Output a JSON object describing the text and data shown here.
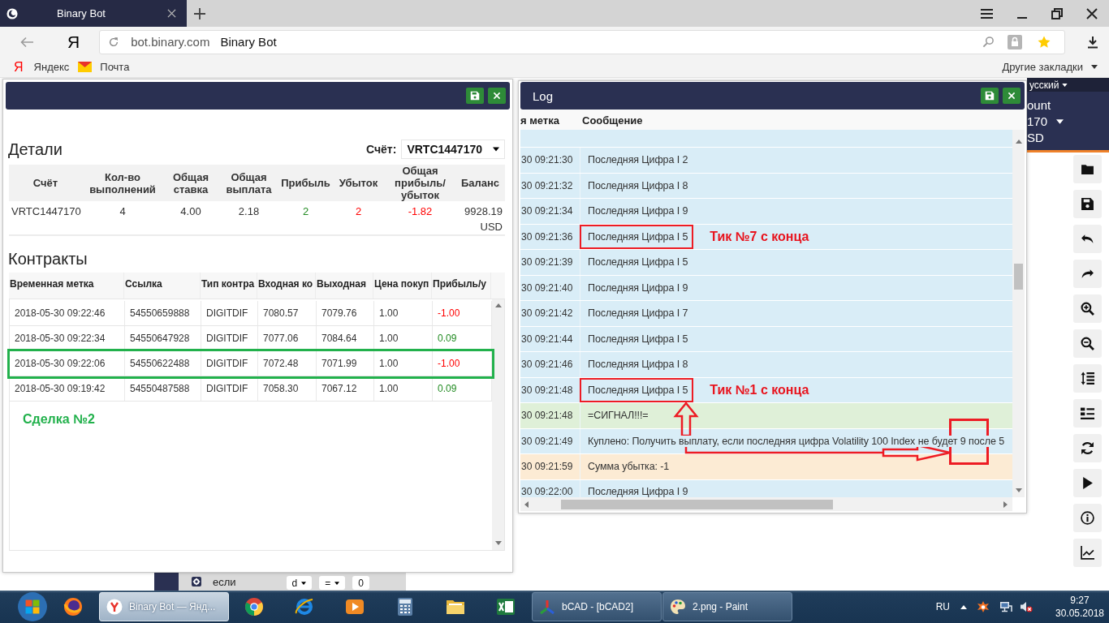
{
  "browser": {
    "tabs": [
      {
        "title": "Binary Bot",
        "selected": true
      }
    ],
    "logo": "Я",
    "address": {
      "domain": "bot.binary.com",
      "page_title": "Binary Bot"
    },
    "bookmarks": [
      {
        "label": "Яндекс",
        "glyph": "Я"
      },
      {
        "label": "Почта"
      }
    ],
    "other_bookmarks": "Другие закладки"
  },
  "app_header": {
    "language": "усский",
    "account_label": "ount",
    "account_id": "170",
    "currency": "SD"
  },
  "details_window": {
    "summary": {
      "title": "Детали",
      "account_label": "Счёт:",
      "account_value": "VRTC1447170",
      "columns": [
        "Счёт",
        "Кол-во выполнений",
        "Общая ставка",
        "Общая выплата",
        "Прибыль",
        "Убыток",
        "Общая прибыль/убыток",
        "Баланс"
      ],
      "row": [
        {
          "text": "VRTC1447170"
        },
        {
          "text": "4"
        },
        {
          "text": "4.00"
        },
        {
          "text": "2.18"
        },
        {
          "text": "2",
          "color": "#228b22"
        },
        {
          "text": "2",
          "color": "#ff0000"
        },
        {
          "text": "-1.82",
          "color": "#ff0000"
        },
        {
          "text": "9928.19 USD"
        }
      ]
    },
    "contracts": {
      "title": "Контракты",
      "columns": [
        "Временная метка",
        "Ссылка",
        "Тип контра",
        "Входная ко",
        "Выходная",
        "Цена покуп",
        "Прибыль/у"
      ],
      "rows": [
        {
          "cells": [
            "2018-05-30 09:22:46",
            "54550659888",
            "DIGITDIF",
            "7080.57",
            "7079.76",
            "1.00"
          ],
          "profit": "-1.00",
          "color": "#ff0000",
          "outlined": false
        },
        {
          "cells": [
            "2018-05-30 09:22:34",
            "54550647928",
            "DIGITDIF",
            "7077.06",
            "7084.64",
            "1.00"
          ],
          "profit": "0.09",
          "color": "#228b22",
          "outlined": false
        },
        {
          "cells": [
            "2018-05-30 09:22:06",
            "54550622488",
            "DIGITDIF",
            "7072.48",
            "7071.99",
            "1.00"
          ],
          "profit": "-1.00",
          "color": "#ff0000",
          "outlined": true
        },
        {
          "cells": [
            "2018-05-30 09:19:42",
            "54550487588",
            "DIGITDIF",
            "7058.30",
            "7067.12",
            "1.00"
          ],
          "profit": "0.09",
          "color": "#228b22",
          "outlined": false
        }
      ],
      "note": "Сделка №2"
    }
  },
  "log_window": {
    "title": "Log",
    "columns": [
      "я метка",
      "Сообщение"
    ],
    "rows": [
      {
        "time": "30 09:21:30",
        "message": "Последняя Цифра I 2",
        "kind": "info",
        "framed": false
      },
      {
        "time": "30 09:21:32",
        "message": "Последняя Цифра I 8",
        "kind": "info",
        "framed": false
      },
      {
        "time": "30 09:21:34",
        "message": "Последняя Цифра I 9",
        "kind": "info",
        "framed": false
      },
      {
        "time": "30 09:21:36",
        "message": "Последняя Цифра I 5",
        "kind": "info",
        "framed": true,
        "note": "Тик №7 с конца"
      },
      {
        "time": "30 09:21:39",
        "message": "Последняя Цифра I 5",
        "kind": "info",
        "framed": false
      },
      {
        "time": "30 09:21:40",
        "message": "Последняя Цифра I 9",
        "kind": "info",
        "framed": false
      },
      {
        "time": "30 09:21:42",
        "message": "Последняя Цифра I 7",
        "kind": "info",
        "framed": false
      },
      {
        "time": "30 09:21:44",
        "message": "Последняя Цифра I 5",
        "kind": "info",
        "framed": false
      },
      {
        "time": "30 09:21:46",
        "message": "Последняя Цифра I 8",
        "kind": "info",
        "framed": false
      },
      {
        "time": "30 09:21:48",
        "message": "Последняя Цифра I 5",
        "kind": "info",
        "framed": true,
        "note": "Тик №1 с конца"
      },
      {
        "time": "30 09:21:48",
        "message": "=СИГНАЛ!!!=",
        "kind": "success",
        "framed": false
      },
      {
        "time": "30 09:21:49",
        "message": "Куплено: Получить выплату, если последняя цифра Volatility 100 Index не будет 9 после 5",
        "kind": "info",
        "framed": false
      },
      {
        "time": "30 09:21:59",
        "message": "Сумма убытка: -1",
        "kind": "warning",
        "framed": false
      },
      {
        "time": "30 09:22:00",
        "message": "Последняя Цифра I 9",
        "kind": "info",
        "framed": false
      }
    ]
  },
  "workspace": {
    "block_label": "если",
    "fields": [
      {
        "text": "d",
        "kind": "dropdown"
      },
      {
        "text": "=",
        "kind": "dropdown"
      },
      {
        "text": "0",
        "kind": "number"
      }
    ]
  },
  "taskbar": {
    "windows": [
      {
        "label": "Binary Bot — Янд...",
        "selected": true
      },
      {
        "label": "bCAD - [bCAD2]",
        "selected": false
      },
      {
        "label": "2.png - Paint",
        "selected": false
      }
    ],
    "language": "RU",
    "time": "9:27",
    "date": "30.05.2018"
  }
}
